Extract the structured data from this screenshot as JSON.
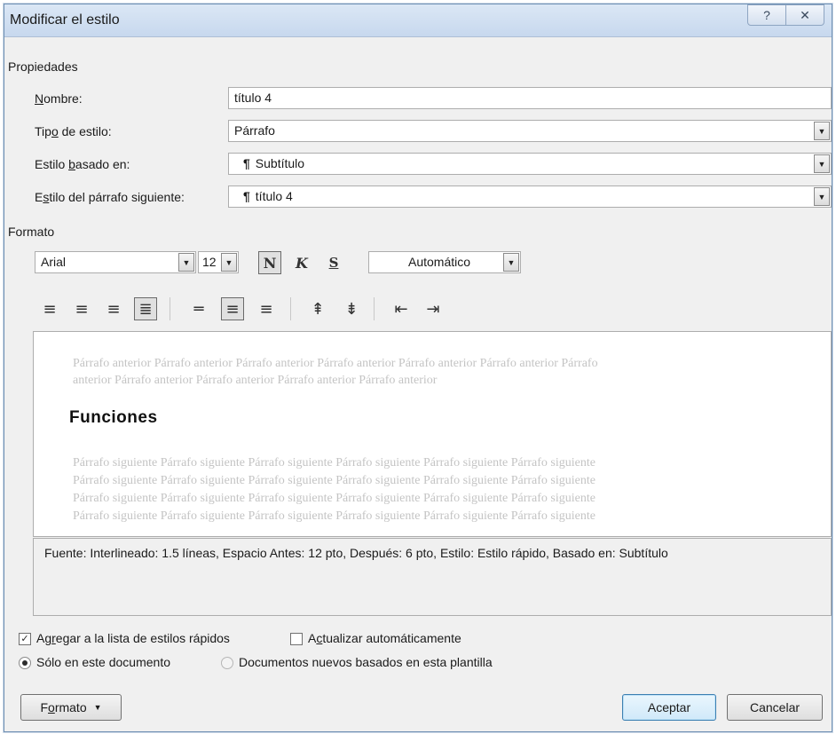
{
  "window": {
    "title": "Modificar el estilo",
    "help_label": "?",
    "close_label": "✕"
  },
  "properties": {
    "section_label": "Propiedades",
    "name": {
      "label_pre": "",
      "label_key": "N",
      "label_post": "ombre:",
      "value": "título 4"
    },
    "style_type": {
      "label_pre": "Tip",
      "label_key": "o",
      "label_post": " de estilo:",
      "value": "Párrafo"
    },
    "based_on": {
      "label_pre": "Estilo ",
      "label_key": "b",
      "label_post": "asado en:",
      "mark": "¶",
      "value": "Subtítulo"
    },
    "next_style": {
      "label_pre": "E",
      "label_key": "s",
      "label_post": "tilo del párrafo siguiente:",
      "mark": "¶",
      "value": "título 4"
    }
  },
  "format": {
    "section_label": "Formato",
    "font": "Arial",
    "size": "12",
    "bold_label": "N",
    "italic_label": "K",
    "underline_label": "S",
    "color": "Automático"
  },
  "preview": {
    "prev_line1": "Párrafo anterior Párrafo anterior Párrafo anterior Párrafo anterior Párrafo anterior Párrafo anterior Párrafo",
    "prev_line2": "anterior Párrafo anterior Párrafo anterior Párrafo anterior Párrafo anterior",
    "heading": "Funciones",
    "next_line": "Párrafo siguiente Párrafo siguiente Párrafo siguiente Párrafo siguiente Párrafo siguiente Párrafo siguiente"
  },
  "description": "Fuente: Interlineado:  1.5 líneas, Espacio Antes:  12 pto, Después:  6 pto, Estilo: Estilo rápido, Basado en: Subtítulo",
  "options": {
    "add_quick": {
      "label_pre": "Ag",
      "label_key": "r",
      "label_post": "egar a la lista de estilos rápidos",
      "checked": true
    },
    "auto_update": {
      "label_pre": "A",
      "label_key": "c",
      "label_post": "tualizar automáticamente",
      "checked": false
    },
    "only_doc": {
      "label": "Sólo en este documento",
      "selected": true
    },
    "new_docs": {
      "label": "Documentos nuevos basados en esta plantilla",
      "selected": false
    }
  },
  "buttons": {
    "format_pre": "F",
    "format_key": "o",
    "format_post": "rmato",
    "accept": "Aceptar",
    "cancel": "Cancelar"
  },
  "colors": {
    "title_bar": "#c7d8ee",
    "dialog_bg": "#f0f0f0",
    "ghost_text": "#c4c4c4",
    "accept_border": "#3c7fb1"
  }
}
